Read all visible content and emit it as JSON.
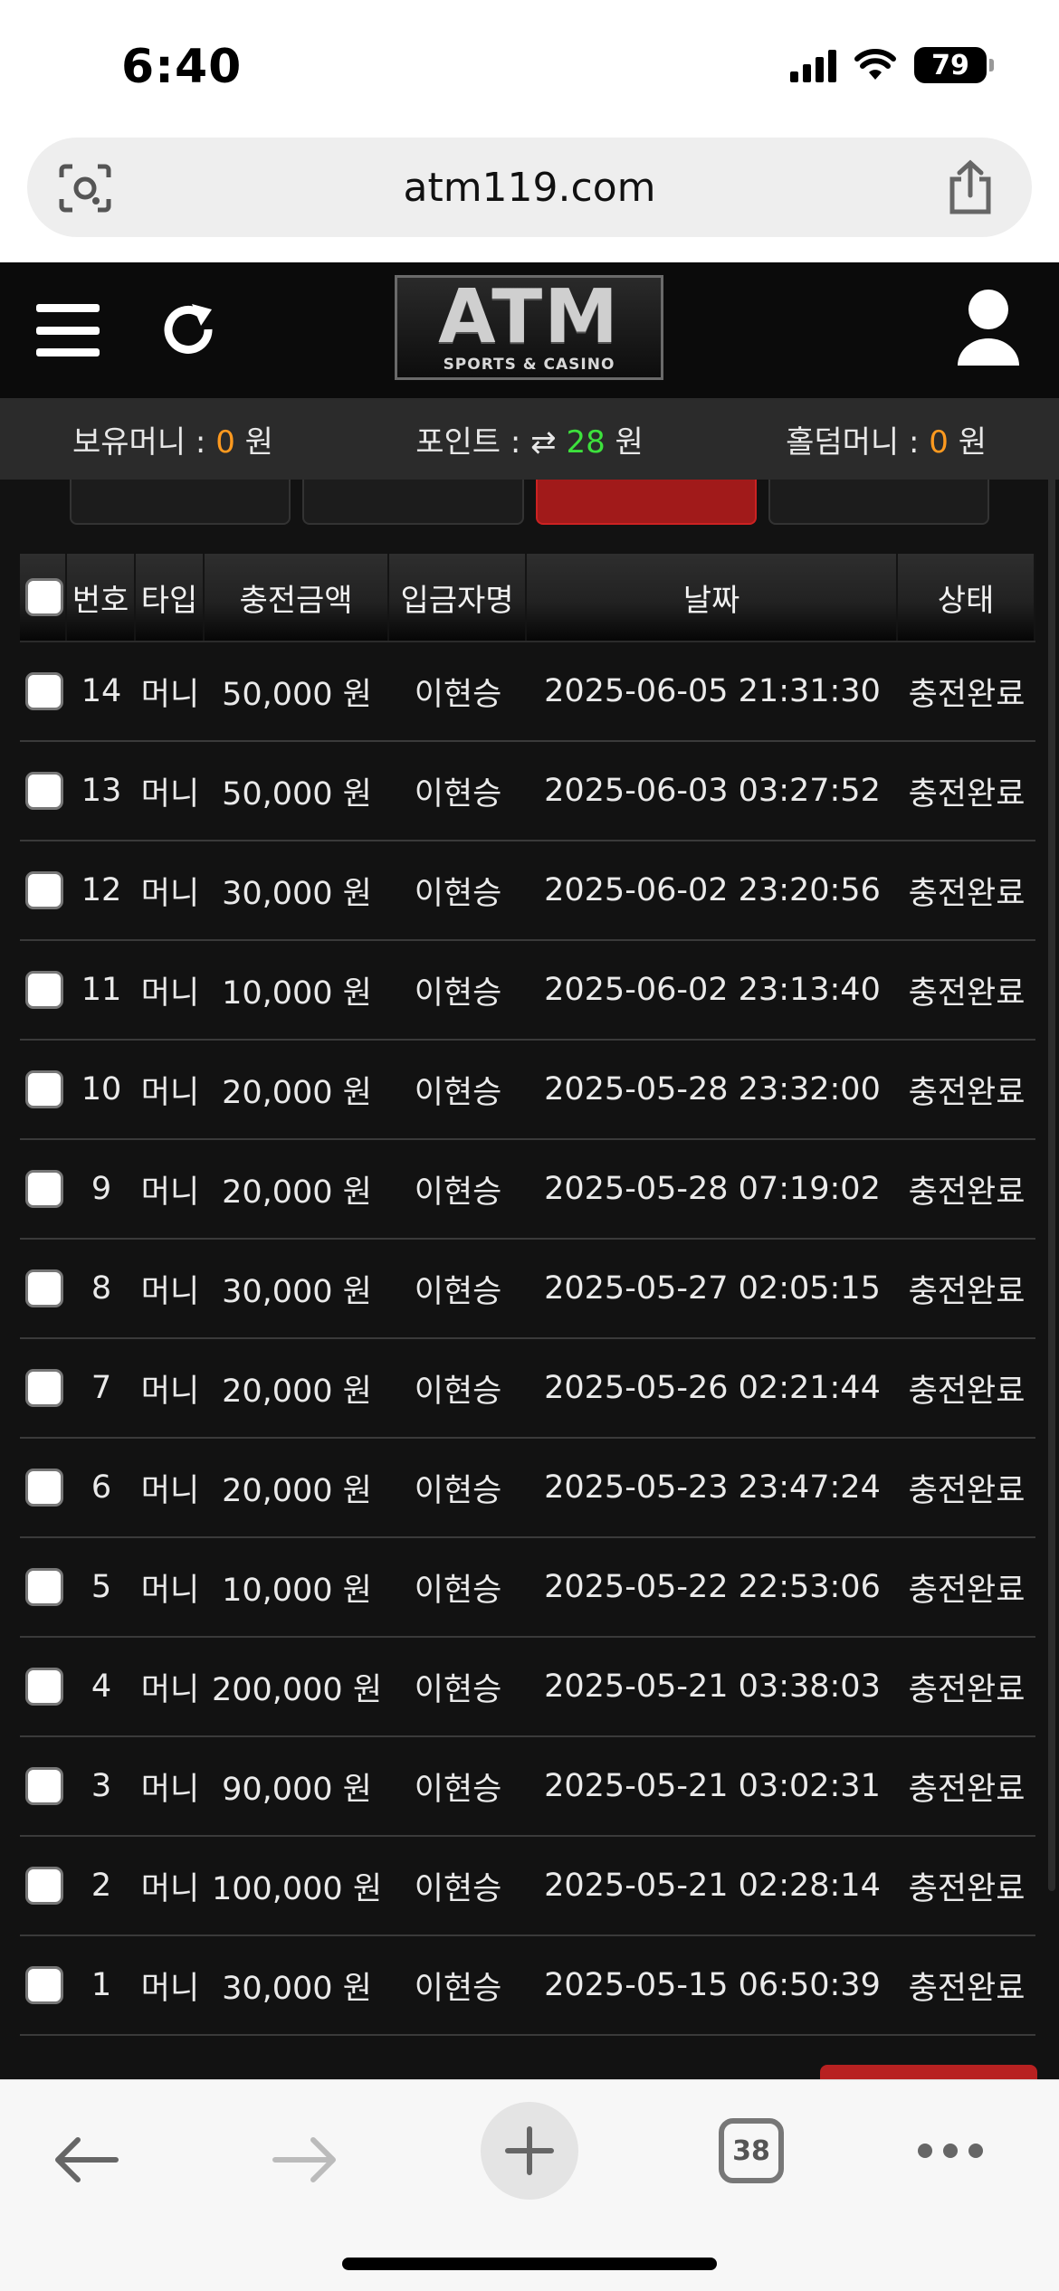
{
  "status_bar": {
    "time": "6:40",
    "battery": "79"
  },
  "browser": {
    "url": "atm119.com",
    "tab_count": "38"
  },
  "header": {
    "logo_main": "ATM",
    "logo_sub": "SPORTS & CASINO"
  },
  "money_bar": {
    "hold_money_label": "보유머니 : ",
    "hold_money_value": "0",
    "point_label": "포인트 : ",
    "point_value": "28",
    "holdem_label": "홀덤머니 : ",
    "holdem_value": "0",
    "unit": "원"
  },
  "colors": {
    "orange": "#ff9a1f",
    "green": "#3de13d",
    "accent_red": "#a11a1a"
  },
  "table": {
    "headers": [
      "번호",
      "타입",
      "충전금액",
      "입금자명",
      "날짜",
      "상태"
    ],
    "rows": [
      {
        "no": "14",
        "type": "머니",
        "amount": "50,000 원",
        "name": "이현승",
        "date": "2025-06-05 21:31:30",
        "status": "충전완료"
      },
      {
        "no": "13",
        "type": "머니",
        "amount": "50,000 원",
        "name": "이현승",
        "date": "2025-06-03 03:27:52",
        "status": "충전완료"
      },
      {
        "no": "12",
        "type": "머니",
        "amount": "30,000 원",
        "name": "이현승",
        "date": "2025-06-02 23:20:56",
        "status": "충전완료"
      },
      {
        "no": "11",
        "type": "머니",
        "amount": "10,000 원",
        "name": "이현승",
        "date": "2025-06-02 23:13:40",
        "status": "충전완료"
      },
      {
        "no": "10",
        "type": "머니",
        "amount": "20,000 원",
        "name": "이현승",
        "date": "2025-05-28 23:32:00",
        "status": "충전완료"
      },
      {
        "no": "9",
        "type": "머니",
        "amount": "20,000 원",
        "name": "이현승",
        "date": "2025-05-28 07:19:02",
        "status": "충전완료"
      },
      {
        "no": "8",
        "type": "머니",
        "amount": "30,000 원",
        "name": "이현승",
        "date": "2025-05-27 02:05:15",
        "status": "충전완료"
      },
      {
        "no": "7",
        "type": "머니",
        "amount": "20,000 원",
        "name": "이현승",
        "date": "2025-05-26 02:21:44",
        "status": "충전완료"
      },
      {
        "no": "6",
        "type": "머니",
        "amount": "20,000 원",
        "name": "이현승",
        "date": "2025-05-23 23:47:24",
        "status": "충전완료"
      },
      {
        "no": "5",
        "type": "머니",
        "amount": "10,000 원",
        "name": "이현승",
        "date": "2025-05-22 22:53:06",
        "status": "충전완료"
      },
      {
        "no": "4",
        "type": "머니",
        "amount": "200,000 원",
        "name": "이현승",
        "date": "2025-05-21 03:38:03",
        "status": "충전완료"
      },
      {
        "no": "3",
        "type": "머니",
        "amount": "90,000 원",
        "name": "이현승",
        "date": "2025-05-21 03:02:31",
        "status": "충전완료"
      },
      {
        "no": "2",
        "type": "머니",
        "amount": "100,000 원",
        "name": "이현승",
        "date": "2025-05-21 02:28:14",
        "status": "충전완료"
      },
      {
        "no": "1",
        "type": "머니",
        "amount": "30,000 원",
        "name": "이현승",
        "date": "2025-05-15 06:50:39",
        "status": "충전완료"
      }
    ]
  }
}
